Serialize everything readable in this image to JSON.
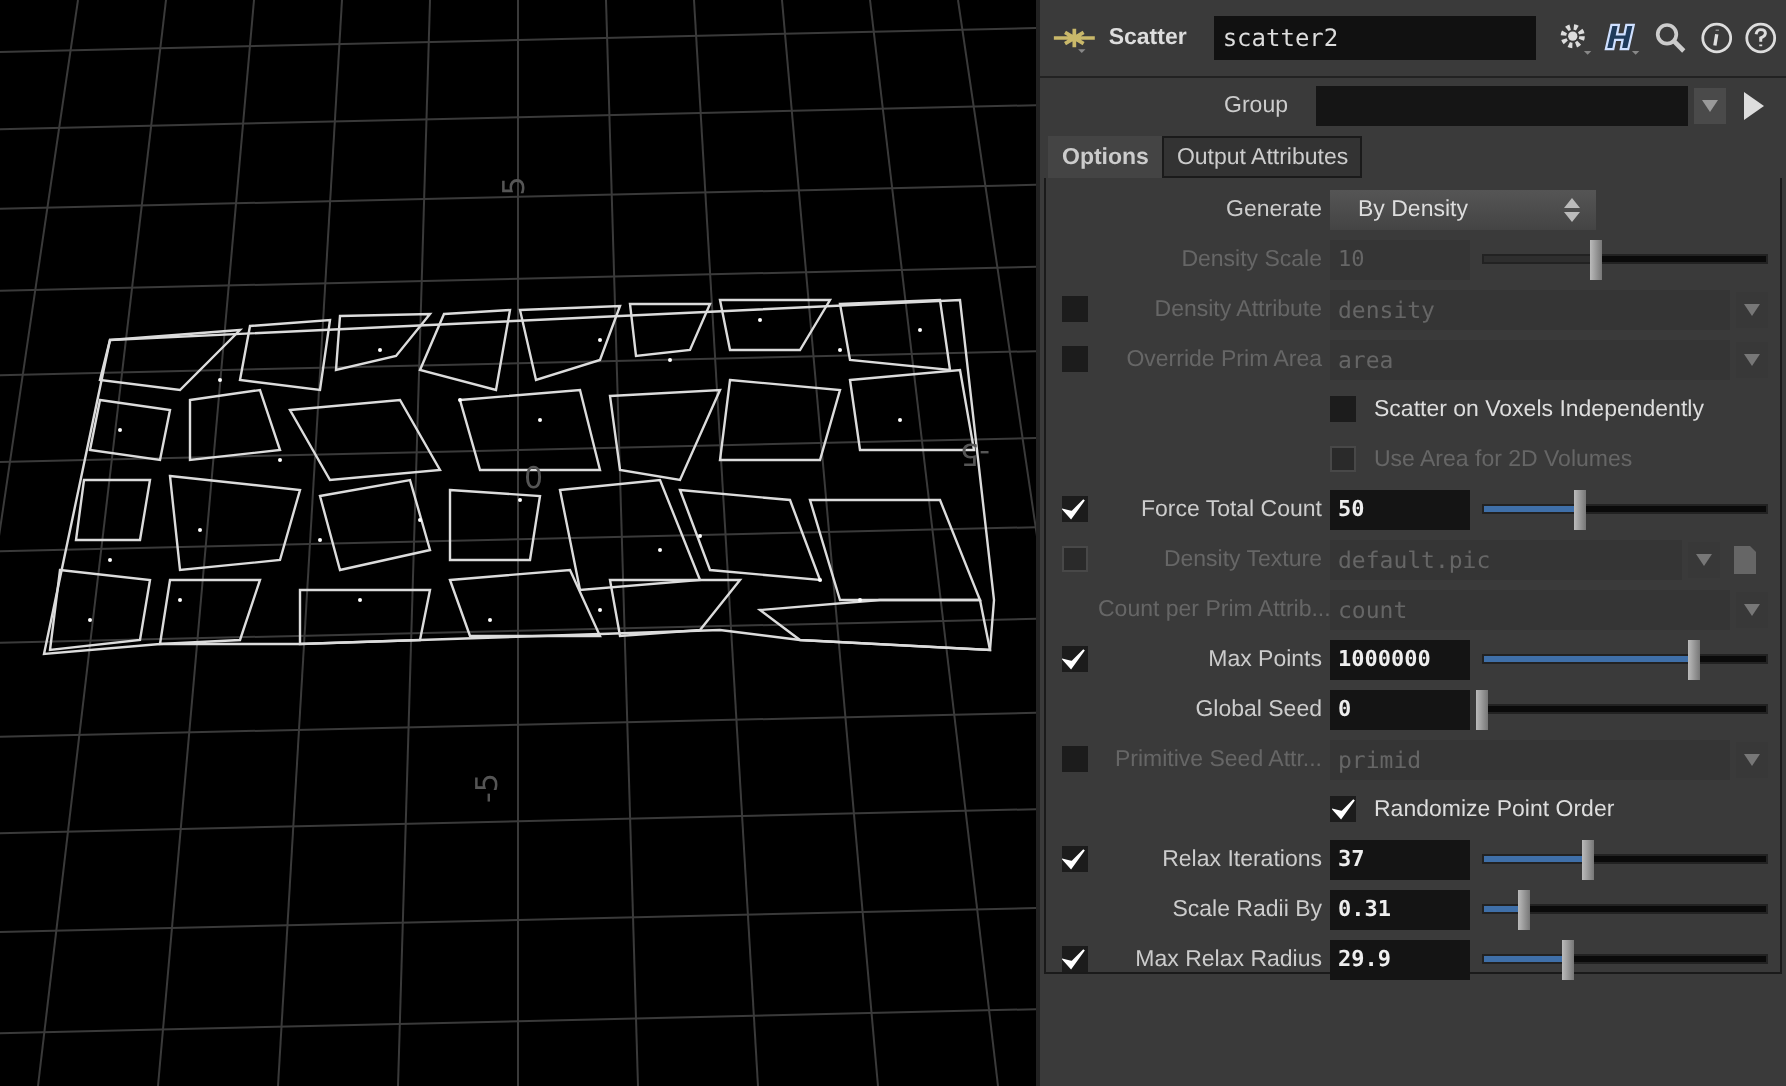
{
  "viewport": {
    "axis_labels": [
      {
        "text": "5",
        "kind": "vertical"
      },
      {
        "text": "0",
        "kind": "flat"
      },
      {
        "text": "-5",
        "kind": "vertical"
      },
      {
        "text": "-5",
        "kind": "flipped"
      }
    ]
  },
  "node": {
    "type": "Scatter",
    "name": "scatter2"
  },
  "group": {
    "label": "Group"
  },
  "tabs": [
    {
      "label": "Options",
      "selected": true
    },
    {
      "label": "Output Attributes",
      "selected": false
    }
  ],
  "params": [
    {
      "kind": "menu",
      "label": "Generate",
      "value": "By Density",
      "disabled": false
    },
    {
      "kind": "slider",
      "label": "Density Scale",
      "value": "10",
      "level": 0.4,
      "disabled": true
    },
    {
      "kind": "string",
      "label": "Density Attribute",
      "value": "density",
      "disabled": true,
      "toggle": {
        "checked": false
      }
    },
    {
      "kind": "string",
      "label": "Override Prim Area",
      "value": "area",
      "disabled": true,
      "toggle": {
        "checked": false
      }
    },
    {
      "kind": "check",
      "label": "Scatter on Voxels Independently",
      "checked": false,
      "disabled": false
    },
    {
      "kind": "check",
      "label": "Use Area for 2D Volumes",
      "checked": false,
      "disabled": true
    },
    {
      "kind": "slider",
      "label": "Force Total Count",
      "value": "50",
      "level": 0.34,
      "disabled": false,
      "toggle": {
        "checked": true
      }
    },
    {
      "kind": "file",
      "label": "Density Texture",
      "value": "default.pic",
      "disabled": true,
      "toggle": {
        "checked": false
      }
    },
    {
      "kind": "string",
      "label": "Count per Prim Attrib...",
      "value": "count",
      "disabled": true
    },
    {
      "kind": "slider",
      "label": "Max Points",
      "value": "1000000",
      "level": 0.74,
      "disabled": false,
      "toggle": {
        "checked": true
      }
    },
    {
      "kind": "slider",
      "label": "Global Seed",
      "value": "0",
      "level": 0,
      "disabled": false
    },
    {
      "kind": "string",
      "label": "Primitive Seed Attr...",
      "value": "primid",
      "disabled": true,
      "toggle": {
        "checked": false
      }
    },
    {
      "kind": "check",
      "label": "Randomize Point Order",
      "checked": true,
      "disabled": false
    },
    {
      "kind": "slider",
      "label": "Relax Iterations",
      "value": "37",
      "level": 0.37,
      "disabled": false,
      "toggle": {
        "checked": true
      }
    },
    {
      "kind": "slider",
      "label": "Scale Radii By",
      "value": "0.31",
      "level": 0.15,
      "disabled": false
    },
    {
      "kind": "slider",
      "label": "Max Relax Radius",
      "value": "29.9",
      "level": 0.3,
      "disabled": false,
      "toggle": {
        "checked": true
      }
    }
  ]
}
